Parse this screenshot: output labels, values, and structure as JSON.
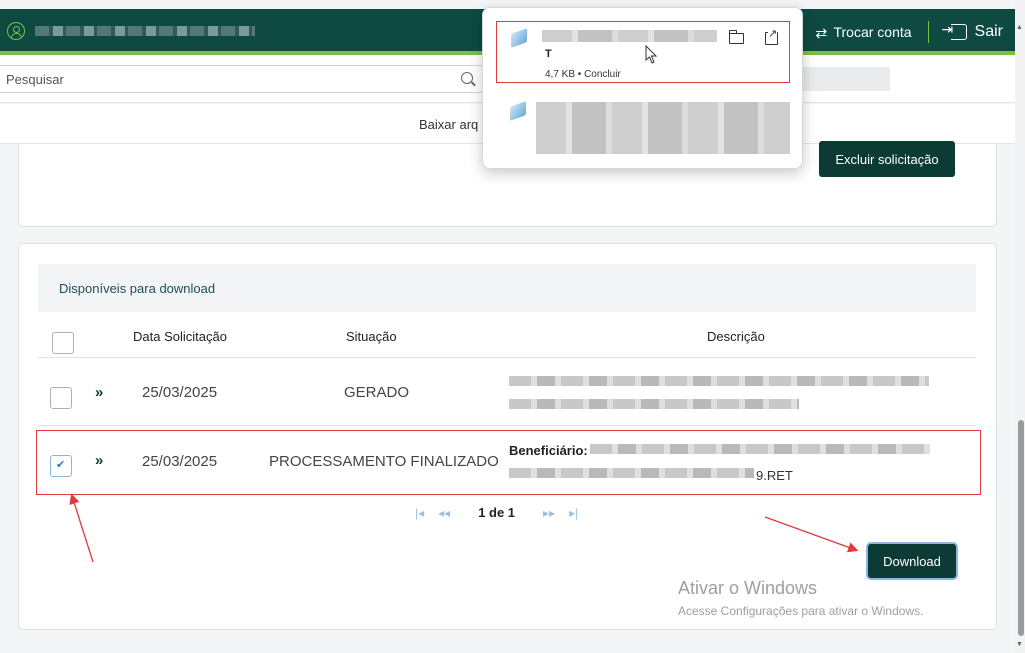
{
  "header": {
    "switch_account": "Trocar conta",
    "logout": "Sair"
  },
  "search": {
    "placeholder": "Pesquisar"
  },
  "subbar": {
    "download_link": "Baixar arq"
  },
  "top_card": {
    "delete_button": "Excluir solicitação"
  },
  "downloads_section": {
    "title": "Disponíveis para download",
    "columns": [
      "Data Solicitação",
      "Situação",
      "Descrição"
    ],
    "rows": [
      {
        "date": "25/03/2025",
        "status": "GERADO",
        "checked": false,
        "description_label": "",
        "description_suffix": ""
      },
      {
        "date": "25/03/2025",
        "status": "PROCESSAMENTO FINALIZADO",
        "checked": true,
        "description_label": "Beneficiário:",
        "description_suffix": "9.RET"
      }
    ],
    "pagination": "1 de 1",
    "download_button": "Download"
  },
  "watermark": {
    "line1": "Ativar o Windows",
    "line2": "Acesse Configurações para ativar o Windows."
  },
  "download_popup": {
    "item1": {
      "name": "T",
      "status": "4,7 KB • Concluir"
    }
  },
  "colors": {
    "header_bg": "#0e4a42",
    "header_accent": "#7ac143",
    "button_dark": "#0c3b36",
    "highlight_red": "#e0393e",
    "checkbox_blue": "#2a6fd0"
  }
}
